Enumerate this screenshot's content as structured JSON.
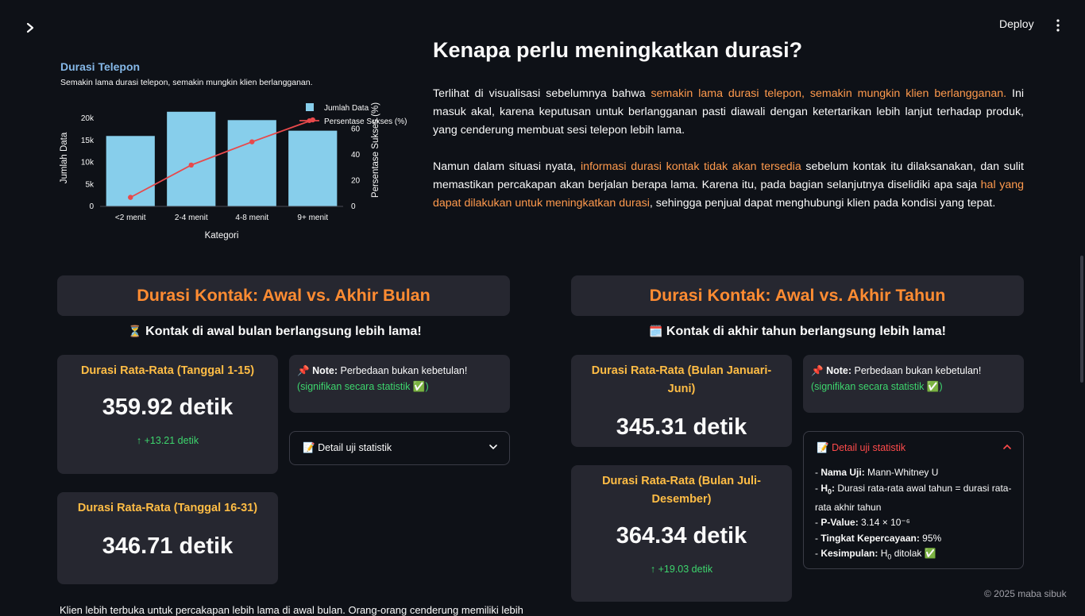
{
  "toolbar": {
    "deploy_label": "Deploy"
  },
  "chart_card": {
    "title": "Durasi Telepon",
    "subtitle": "Semakin lama durasi telepon, semakin mungkin klien berlangganan."
  },
  "chart_data": {
    "type": "bar",
    "categories": [
      "<2 menit",
      "2-4 menit",
      "4-8 menit",
      "9+ menit"
    ],
    "series": [
      {
        "name": "Jumlah Data",
        "type": "bar",
        "axis": "left",
        "values": [
          16000,
          21500,
          19600,
          17200
        ],
        "color": "#87ceeb"
      },
      {
        "name": "Persentase Sukses (%)",
        "type": "line",
        "axis": "right",
        "values": [
          7,
          32,
          50,
          67
        ],
        "color": "#e8494b"
      }
    ],
    "xlabel": "Kategori",
    "ylabel": "Jumlah Data",
    "y2label": "Persentase Sukses (%)",
    "ylim": [
      0,
      22000
    ],
    "y2lim": [
      0,
      75
    ],
    "yticks": [
      "0",
      "5k",
      "10k",
      "15k",
      "20k"
    ],
    "y2ticks": [
      "0",
      "20",
      "40",
      "60"
    ],
    "legend": "top-right"
  },
  "intro": {
    "heading": "Kenapa perlu meningkatkan durasi?",
    "p1_a": "Terlihat di visualisasi sebelumnya bahwa ",
    "p1_hl": "semakin lama durasi telepon, semakin mungkin klien berlangganan.",
    "p1_b": " Ini masuk akal, karena keputusan untuk berlangganan pasti diawali dengan ketertarikan lebih lanjut terhadap produk, yang cenderung membuat sesi telepon lebih lama.",
    "p2_a": "Namun dalam situasi nyata, ",
    "p2_hl1": "informasi durasi kontak tidak akan tersedia",
    "p2_b": " sebelum kontak itu dilaksanakan, dan sulit memastikan percakapan akan berjalan berapa lama. Karena itu, pada bagian selanjutnya diselidiki apa saja ",
    "p2_hl2": "hal yang dapat dilakukan untuk meningkatkan durasi",
    "p2_c": ", sehingga penjual dapat menghubungi klien pada kondisi yang tepat."
  },
  "left": {
    "header": "Durasi Kontak: Awal vs. Akhir Bulan",
    "subheading": "Kontak di awal bulan berlangsung lebih lama!",
    "metric1": {
      "label": "Durasi Rata-Rata (Tanggal 1-15)",
      "value": "359.92 detik",
      "delta": "+13.21 detik"
    },
    "metric2": {
      "label": "Durasi Rata-Rata (Tanggal 16-31)",
      "value": "346.71 detik"
    },
    "note_bold": "Note:",
    "note_text": " Perbedaan bukan kebetulan!",
    "note_green": "(signifikan secara statistik ✅)",
    "expander_label": "Detail uji statistik",
    "bottom_text": "Klien lebih terbuka untuk percakapan lebih lama di awal bulan. Orang-orang cenderung memiliki lebih"
  },
  "right": {
    "header": "Durasi Kontak: Awal vs. Akhir Tahun",
    "subheading": "Kontak di akhir tahun berlangsung lebih lama!",
    "metric1": {
      "label": "Durasi Rata-Rata (Bulan Januari-Juni)",
      "value": "345.31 detik"
    },
    "metric2": {
      "label": "Durasi Rata-Rata (Bulan Juli-Desember)",
      "value": "364.34 detik",
      "delta": "+19.03 detik"
    },
    "note_bold": "Note:",
    "note_text": " Perbedaan bukan kebetulan!",
    "note_green": "(signifikan secara statistik ✅)",
    "expander_label": "Detail uji statistik",
    "detail": {
      "name_label": "Nama Uji:",
      "name_value": " Mann-Whitney U",
      "h0_label": "H",
      "h0_sub": "0",
      "h0_colon": ":",
      "h0_value": " Durasi rata-rata awal tahun = durasi rata-rata akhir tahun",
      "p_label": "P-Value:",
      "p_value": " 3.14 × 10⁻⁶",
      "conf_label": "Tingkat Kepercayaan:",
      "conf_value": " 95%",
      "concl_label": "Kesimpulan:",
      "concl_h": " H",
      "concl_sub": "0",
      "concl_value": " ditolak ✅"
    }
  },
  "footer": {
    "text": "© 2025 maba sibuk"
  }
}
